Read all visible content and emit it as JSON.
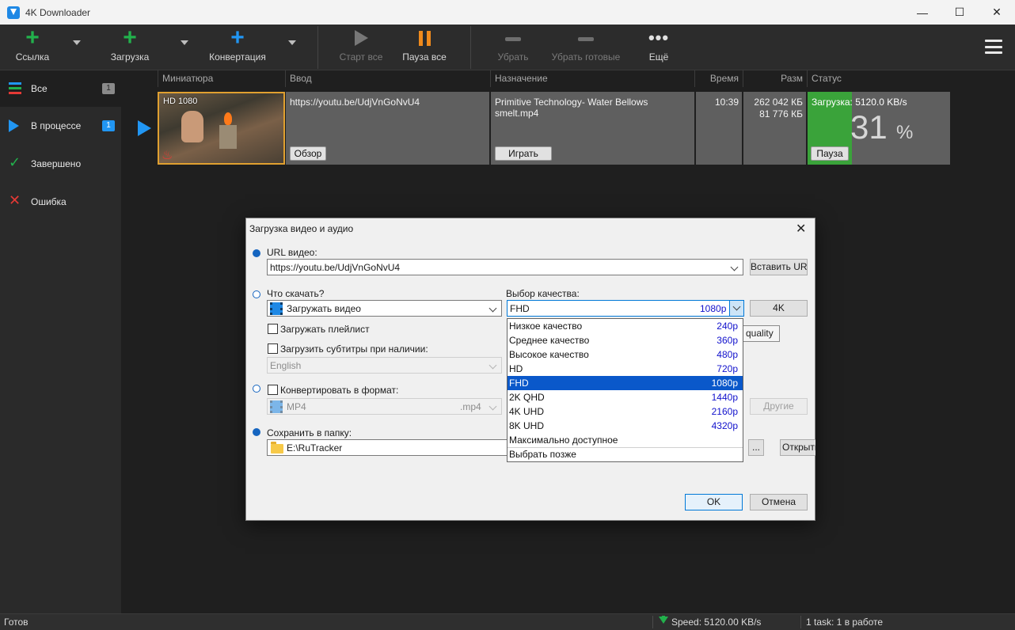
{
  "window": {
    "title": "4K Downloader",
    "minimize": "—",
    "maximize": "☐",
    "close": "✕"
  },
  "toolbar": {
    "link_label": "Ссылка",
    "download_label": "Загрузка",
    "convert_label": "Конвертация",
    "start_all_label": "Старт все",
    "pause_all_label": "Пауза все",
    "remove_label": "Убрать",
    "remove_done_label": "Убрать готовые",
    "more_label": "Ещё",
    "more_icon": "•••"
  },
  "sidebar": {
    "items": [
      {
        "label": "Все",
        "count": "1",
        "icon": "list-icon"
      },
      {
        "label": "В процессе",
        "count": "1",
        "icon": "play-icon"
      },
      {
        "label": "Завершено",
        "icon": "check-icon"
      },
      {
        "label": "Ошибка",
        "icon": "error-icon"
      }
    ]
  },
  "table": {
    "columns": [
      "Миниатюра",
      "Ввод",
      "Назначение",
      "Время",
      "Разм",
      "Статус"
    ],
    "row": {
      "thumb_badge": "HD 1080",
      "input_url": "https://youtu.be/UdjVnGoNvU4",
      "browse_label": "Обзор",
      "destination": "Primitive Technology- Water Bellows smelt.mp4",
      "play_label": "Играть",
      "time": "10:39",
      "size_total": "262 042 КБ",
      "size_done": "81 776 КБ",
      "status_text": "Загрузка: 5120.0 KB/s",
      "progress_value": "31",
      "progress_unit": "%",
      "progress_fraction": 0.31,
      "pause_label": "Пауза"
    }
  },
  "statusbar": {
    "status": "Готов",
    "speed": "Speed: 5120.00 KB/s",
    "tasks": "1 task: 1 в работе"
  },
  "dialog": {
    "title": "Загрузка видео и аудио",
    "close": "✕",
    "url_label": "URL видео:",
    "url_value": "https://youtu.be/UdjVnGoNvU4",
    "paste_url_label": "Вставить URL",
    "what_label": "Что скачать?",
    "what_value": "Загружать видео",
    "playlist_label": "Загружать плейлист",
    "subtitles_label": "Загрузить субтитры при наличии:",
    "subtitles_lang": "English",
    "convert_label": "Конвертировать в формат:",
    "format_value": "MP4",
    "format_ext": ".mp4",
    "others_label": "Другие",
    "save_label": "Сохранить в папку:",
    "save_path": "E:\\RuTracker",
    "browse_label": "...",
    "open_label": "Открыть",
    "quality_label": "Выбор качества:",
    "quality_value": "FHD",
    "quality_res": "1080p",
    "fourk_label": "4K",
    "tooltip_text": "quality",
    "ok_label": "OK",
    "cancel_label": "Отмена",
    "quality_options": [
      {
        "name": "Низкое качество",
        "res": "240p"
      },
      {
        "name": "Среднее качество",
        "res": "360p"
      },
      {
        "name": "Высокое качество",
        "res": "480p"
      },
      {
        "name": "HD",
        "res": "720p"
      },
      {
        "name": "FHD",
        "res": "1080p"
      },
      {
        "name": "2K QHD",
        "res": "1440p"
      },
      {
        "name": "4K UHD",
        "res": "2160p"
      },
      {
        "name": "8K UHD",
        "res": "4320p"
      },
      {
        "name": "Максимально доступное",
        "res": ""
      },
      {
        "name": "Выбрать позже",
        "res": ""
      }
    ]
  },
  "colors": {
    "accent_blue": "#2196f3",
    "add_green": "#22b14c",
    "pause_orange": "#f08a1c",
    "progress_green": "#3aa33a",
    "error_red": "#e53935"
  }
}
